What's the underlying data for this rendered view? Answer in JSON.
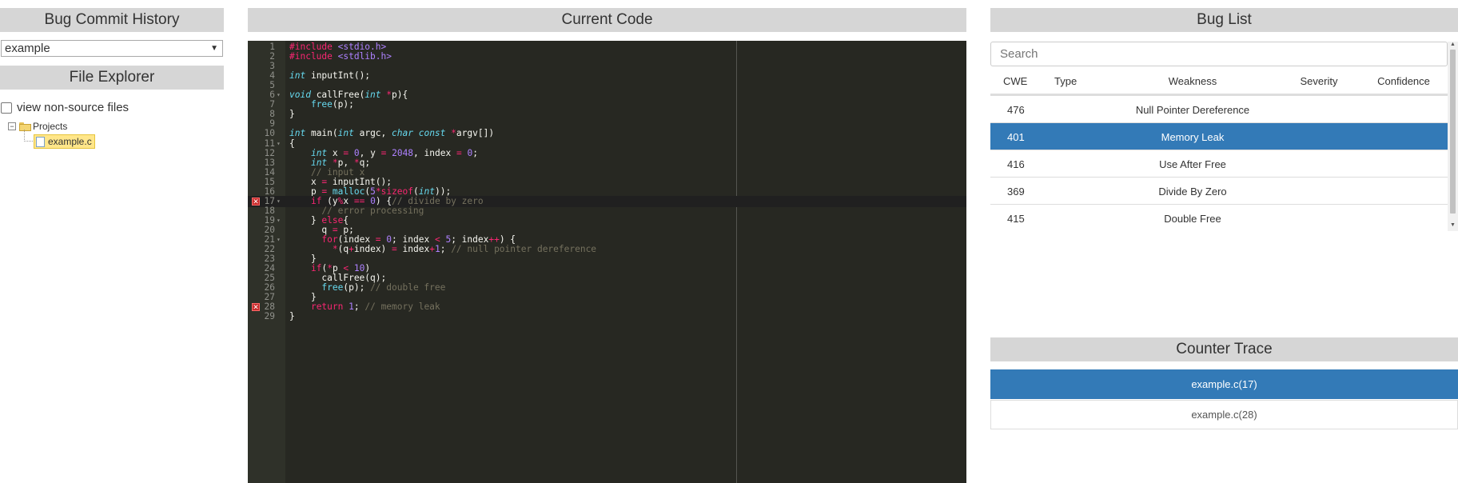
{
  "bug_commit_history": {
    "title": "Bug Commit History",
    "selected": "example"
  },
  "file_explorer": {
    "title": "File Explorer",
    "nonsource_label": "view non-source files",
    "folder": "Projects",
    "file": "example.c"
  },
  "current_code": {
    "title": "Current Code",
    "line_numbers": [
      "1",
      "2",
      "3",
      "4",
      "5",
      "6",
      "7",
      "8",
      "9",
      "10",
      "11",
      "12",
      "13",
      "14",
      "15",
      "16",
      "17",
      "18",
      "19",
      "20",
      "21",
      "22",
      "23",
      "24",
      "25",
      "26",
      "27",
      "28",
      "29"
    ],
    "lines": [
      "#include <stdio.h>",
      "#include <stdlib.h>",
      "",
      "int inputInt();",
      "",
      "void callFree(int *p){",
      "    free(p);",
      "}",
      "",
      "int main(int argc, char const *argv[])",
      "{",
      "    int x = 0, y = 2048, index = 0;",
      "    int *p, *q;",
      "    // input x",
      "    x = inputInt();",
      "    p = malloc(5*sizeof(int));",
      "    if (y%x == 0) {// divide by zero",
      "      // error processing",
      "    } else{",
      "      q = p;",
      "      for(index = 0; index < 5; index++) {",
      "        *(q+index) = index+1; // null pointer dereference",
      "    }",
      "    if(*p < 10)",
      "      callFree(q);",
      "      free(p); // double free",
      "    }",
      "    return 1; // memory leak",
      "}"
    ],
    "error_lines": [
      "17",
      "28"
    ],
    "active_line": "17"
  },
  "bug_list": {
    "title": "Bug List",
    "search_placeholder": "Search",
    "columns": [
      "CWE",
      "Type",
      "Weakness",
      "Severity",
      "Confidence"
    ],
    "rows": [
      {
        "cwe": "476",
        "weakness": "Null Pointer Dereference",
        "selected": false
      },
      {
        "cwe": "401",
        "weakness": "Memory Leak",
        "selected": true
      },
      {
        "cwe": "416",
        "weakness": "Use After Free",
        "selected": false
      },
      {
        "cwe": "369",
        "weakness": "Divide By Zero",
        "selected": false
      },
      {
        "cwe": "415",
        "weakness": "Double Free",
        "selected": false
      }
    ]
  },
  "counter_trace": {
    "title": "Counter Trace",
    "items": [
      {
        "label": "example.c(17)",
        "selected": true
      },
      {
        "label": "example.c(28)",
        "selected": false
      }
    ]
  },
  "colors": {
    "header_bg": "#d6d6d6",
    "selection": "#337ab7",
    "editor_bg": "#272822",
    "error": "#c72b2b"
  }
}
